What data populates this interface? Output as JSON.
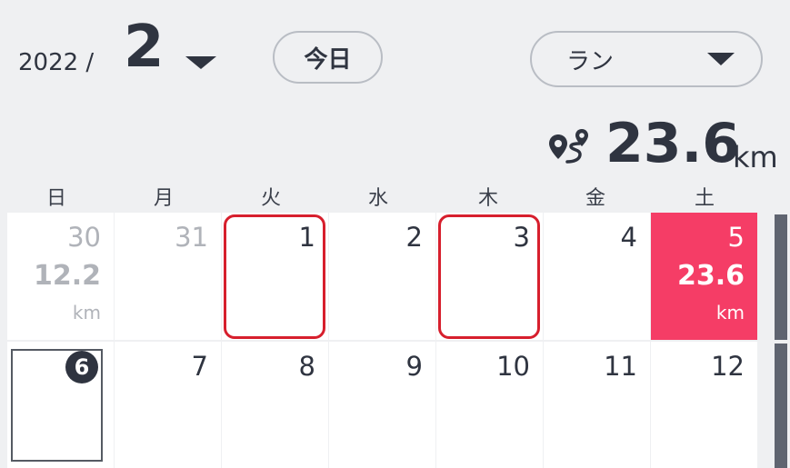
{
  "header": {
    "year": "2022 /",
    "month": "2",
    "today_label": "今日",
    "sport_selected": "ラン"
  },
  "summary": {
    "total_distance": "23.6",
    "unit": "km"
  },
  "weekdays": [
    "日",
    "月",
    "火",
    "水",
    "木",
    "金",
    "土"
  ],
  "weeks": [
    {
      "days": [
        {
          "day": "30",
          "distance": "12.2",
          "unit": "km",
          "muted": true
        },
        {
          "day": "31",
          "muted": true
        },
        {
          "day": "1",
          "highlight": true
        },
        {
          "day": "2"
        },
        {
          "day": "3",
          "highlight": true
        },
        {
          "day": "4"
        },
        {
          "day": "5",
          "distance": "23.6",
          "unit": "km",
          "active": true
        }
      ]
    },
    {
      "days": [
        {
          "day": "6",
          "today": true
        },
        {
          "day": "7"
        },
        {
          "day": "8"
        },
        {
          "day": "9"
        },
        {
          "day": "10"
        },
        {
          "day": "11"
        },
        {
          "day": "12"
        }
      ]
    }
  ],
  "colors": {
    "accent": "#f53d66",
    "highlight_outline": "#d71f2d",
    "background": "#eff0f2"
  },
  "icons": {
    "route": "route-pin-icon",
    "dropdown": "caret-down-icon"
  }
}
